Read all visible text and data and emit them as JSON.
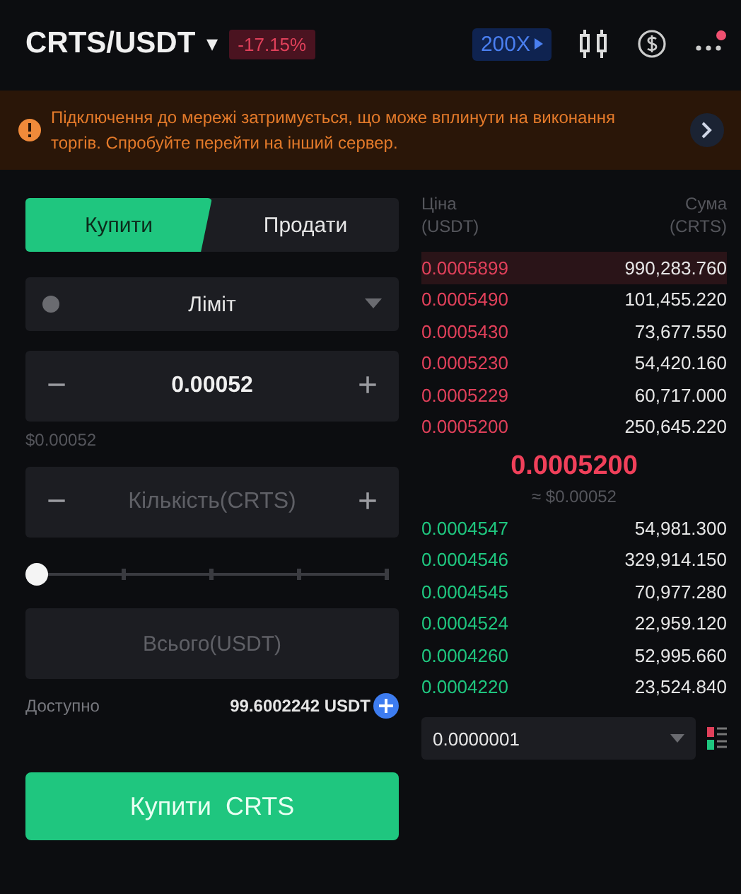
{
  "header": {
    "pair": "CRTS/USDT",
    "caret": "▾",
    "change": "-17.15%",
    "leverage": "200X",
    "has_notification": true
  },
  "banner": {
    "message": "Підключення до мережі затримується, що може вплинути на виконання торгів. Спробуйте перейти на інший сервер."
  },
  "tabs": [
    {
      "label": "Купити",
      "selected": true
    },
    {
      "label": "Продати",
      "selected": false
    }
  ],
  "order_type": {
    "value": "Ліміт"
  },
  "price_field": {
    "value": "0.00052",
    "minus": "−",
    "plus": "+"
  },
  "price_usd": "$0.00052",
  "amount_field": {
    "placeholder": "Кількість(CRTS)",
    "minus": "−",
    "plus": "+"
  },
  "slider": {
    "level": 0
  },
  "total_field": {
    "placeholder": "Всього(USDT)"
  },
  "available": {
    "label": "Доступно",
    "value": "99.6002242 USDT"
  },
  "submit": "Купити  CRTS",
  "orderbook": {
    "columns": [
      {
        "label": "Ціна",
        "unit": "(USDT)"
      },
      {
        "label": "Сума",
        "unit": "(CRTS)"
      }
    ],
    "asks": [
      {
        "price": "0.0005899",
        "amount": "990,283.760"
      },
      {
        "price": "0.0005490",
        "amount": "101,455.220"
      },
      {
        "price": "0.0005430",
        "amount": "73,677.550"
      },
      {
        "price": "0.0005230",
        "amount": "54,420.160"
      },
      {
        "price": "0.0005229",
        "amount": "60,717.000"
      },
      {
        "price": "0.0005200",
        "amount": "250,645.220"
      }
    ],
    "last_price": "0.0005200",
    "last_price_usd": "≈ $0.00052",
    "bids": [
      {
        "price": "0.0004547",
        "amount": "54,981.300"
      },
      {
        "price": "0.0004546",
        "amount": "329,914.150"
      },
      {
        "price": "0.0004545",
        "amount": "70,977.280"
      },
      {
        "price": "0.0004524",
        "amount": "22,959.120"
      },
      {
        "price": "0.0004260",
        "amount": "52,995.660"
      },
      {
        "price": "0.0004220",
        "amount": "23,524.840"
      }
    ],
    "precision": "0.0000001"
  }
}
